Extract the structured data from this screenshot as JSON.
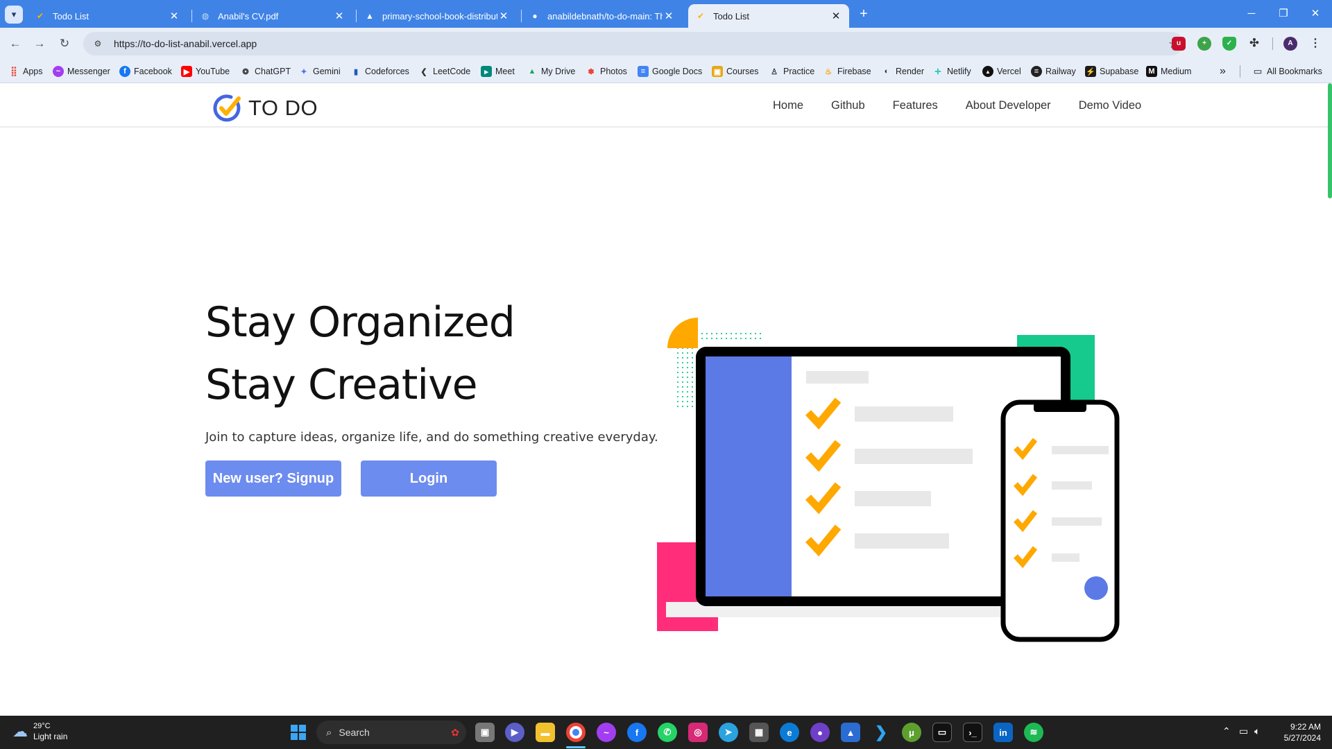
{
  "browser": {
    "tabs": [
      {
        "label": "Todo List",
        "active": false
      },
      {
        "label": "Anabil's CV.pdf",
        "active": false
      },
      {
        "label": "primary-school-book-distributi",
        "active": false
      },
      {
        "label": "anabildebnath/to-do-main: Thi",
        "active": false
      },
      {
        "label": "Todo List",
        "active": true
      }
    ],
    "url": "https://to-do-list-anabil.vercel.app",
    "bookmarks": [
      "Apps",
      "Messenger",
      "Facebook",
      "YouTube",
      "ChatGPT",
      "Gemini",
      "Codeforces",
      "LeetCode",
      "Meet",
      "My Drive",
      "Photos",
      "Google Docs",
      "Courses",
      "Practice",
      "Firebase",
      "Render",
      "Netlify",
      "Vercel",
      "Railway",
      "Supabase",
      "Medium"
    ],
    "more_bookmarks": "»",
    "all_bookmarks": "All Bookmarks"
  },
  "site": {
    "brand": "TO DO",
    "nav": [
      "Home",
      "Github",
      "Features",
      "About Developer",
      "Demo Video"
    ],
    "hero_line1": "Stay Organized",
    "hero_line2": "Stay Creative",
    "subtitle": "Join to capture ideas, organize life, and do something creative everyday.",
    "signup_label": "New user? Signup",
    "login_label": "Login"
  },
  "taskbar": {
    "temperature": "29°C",
    "weather": "Light rain",
    "search_placeholder": "Search",
    "time": "9:22 AM",
    "date": "5/27/2024"
  },
  "colors": {
    "accent_blue": "#6d8cef",
    "checkmark": "#ffa800",
    "teal": "#16c98d",
    "pink": "#ff2d7a",
    "chrome_blue": "#3f83e6"
  }
}
